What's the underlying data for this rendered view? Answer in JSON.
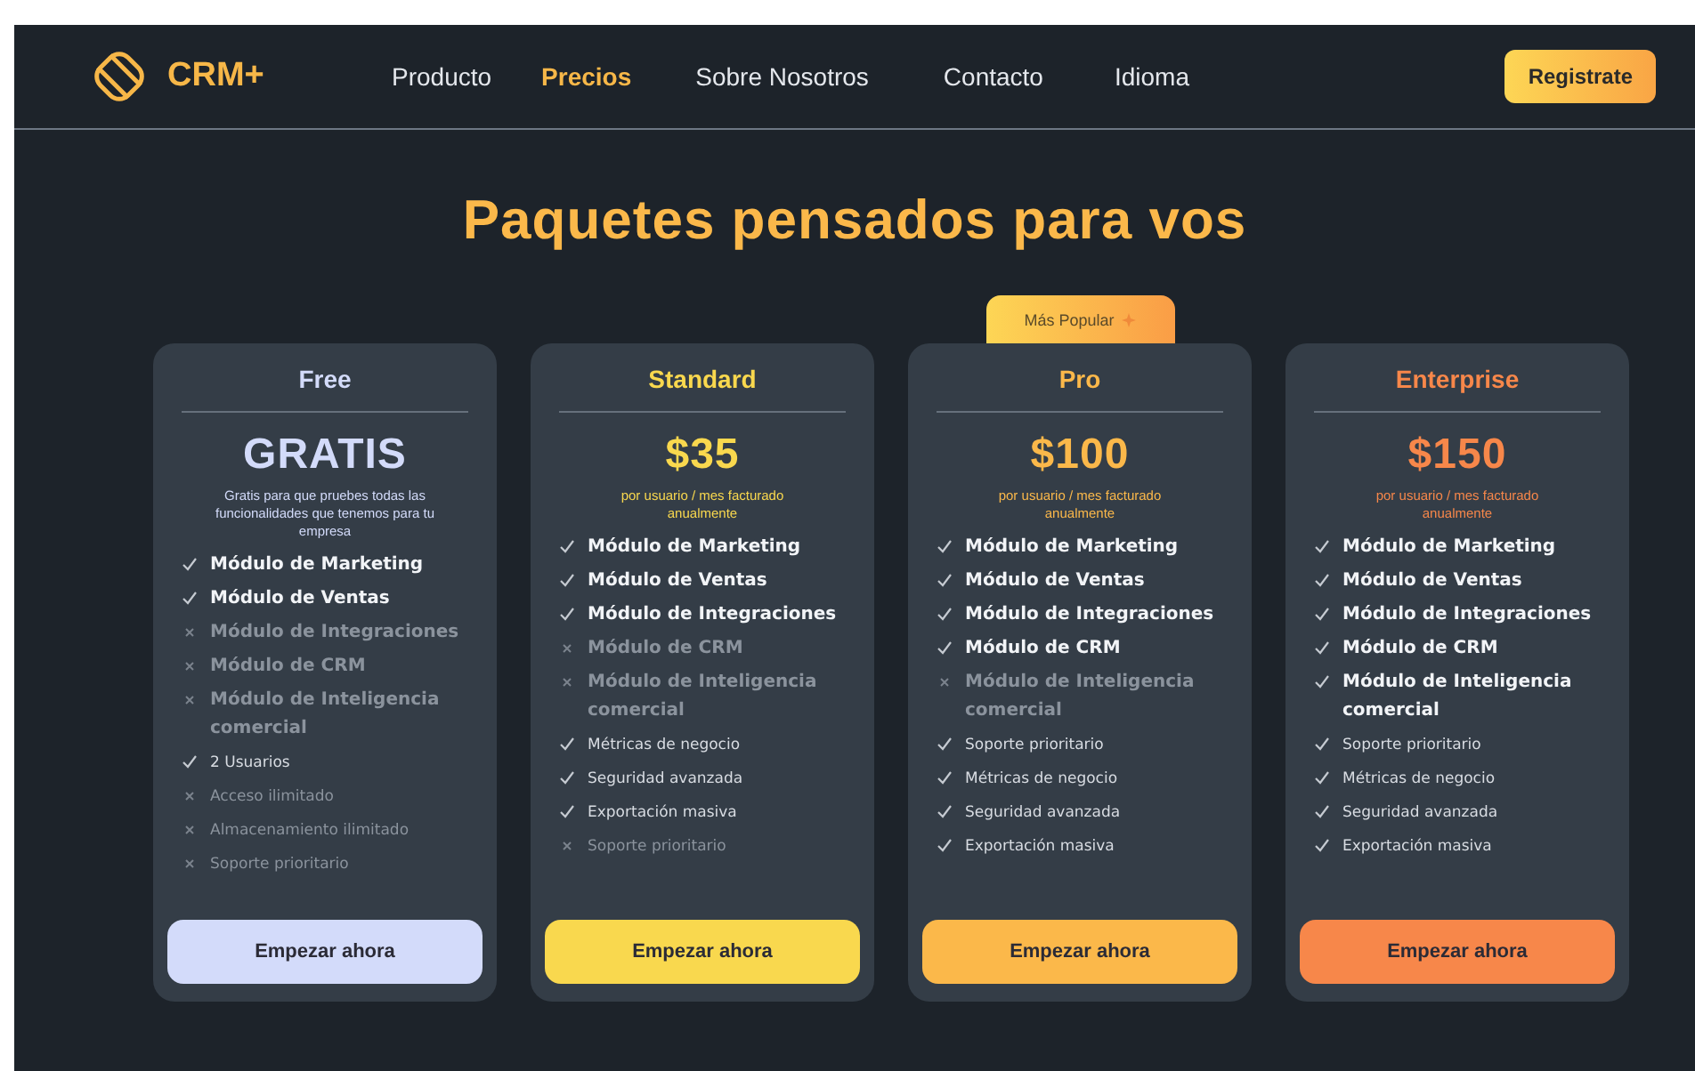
{
  "brand": {
    "name": "CRM+"
  },
  "nav": [
    {
      "label": "Producto",
      "selected": false
    },
    {
      "label": "Precios",
      "selected": true
    },
    {
      "label": "Sobre Nosotros",
      "selected": false
    },
    {
      "label": "Contacto",
      "selected": false
    },
    {
      "label": "Idioma",
      "selected": false
    }
  ],
  "register_button": "Registrate",
  "heading": "Paquetes pensados para vos",
  "plans": [
    {
      "name": "Free",
      "color": "#d3dbfa",
      "price": "GRATIS",
      "note": "Gratis para que pruebes todas las funcionalidades que tenemos para tu empresa",
      "features": [
        {
          "label": "Módulo de Marketing",
          "kind": "module",
          "included": true
        },
        {
          "label": "Módulo de Ventas",
          "kind": "module",
          "included": true
        },
        {
          "label": "Módulo de Integraciones",
          "kind": "module",
          "included": false
        },
        {
          "label": "Módulo de CRM",
          "kind": "module",
          "included": false
        },
        {
          "label": "Módulo de Inteligencia comercial",
          "kind": "module",
          "included": false
        },
        {
          "label": "2 Usuarios",
          "kind": "extra",
          "included": true
        },
        {
          "label": "Acceso ilimitado",
          "kind": "extra",
          "included": false
        },
        {
          "label": "Almacenamiento ilimitado",
          "kind": "extra",
          "included": false
        },
        {
          "label": "Soporte prioritario",
          "kind": "extra",
          "included": false
        }
      ],
      "button": "Empezar ahora"
    },
    {
      "name": "Standard",
      "color": "#f9d84e",
      "price": "$35",
      "note": "por usuario / mes facturado anualmente",
      "features": [
        {
          "label": "Módulo de Marketing",
          "kind": "module",
          "included": true
        },
        {
          "label": "Módulo de Ventas",
          "kind": "module",
          "included": true
        },
        {
          "label": "Módulo de Integraciones",
          "kind": "module",
          "included": true
        },
        {
          "label": "Módulo de CRM",
          "kind": "module",
          "included": false
        },
        {
          "label": "Módulo de Inteligencia comercial",
          "kind": "module",
          "included": false
        },
        {
          "label": "Métricas de negocio",
          "kind": "extra",
          "included": true
        },
        {
          "label": "Seguridad avanzada",
          "kind": "extra",
          "included": true
        },
        {
          "label": "Exportación masiva",
          "kind": "extra",
          "included": true
        },
        {
          "label": "Soporte prioritario",
          "kind": "extra",
          "included": false
        }
      ],
      "button": "Empezar ahora"
    },
    {
      "name": "Pro",
      "color": "#fbb84a",
      "badge": "Más Popular",
      "price": "$100",
      "note": "por usuario / mes facturado anualmente",
      "features": [
        {
          "label": "Módulo de Marketing",
          "kind": "module",
          "included": true
        },
        {
          "label": "Módulo de Ventas",
          "kind": "module",
          "included": true
        },
        {
          "label": "Módulo de Integraciones",
          "kind": "module",
          "included": true
        },
        {
          "label": "Módulo de CRM",
          "kind": "module",
          "included": true
        },
        {
          "label": "Módulo de Inteligencia comercial",
          "kind": "module",
          "included": false
        },
        {
          "label": "Soporte prioritario",
          "kind": "extra",
          "included": true
        },
        {
          "label": "Métricas de negocio",
          "kind": "extra",
          "included": true
        },
        {
          "label": "Seguridad avanzada",
          "kind": "extra",
          "included": true
        },
        {
          "label": "Exportación masiva",
          "kind": "extra",
          "included": true
        }
      ],
      "button": "Empezar ahora"
    },
    {
      "name": "Enterprise",
      "color": "#f7874a",
      "price": "$150",
      "note": "por usuario / mes facturado anualmente",
      "features": [
        {
          "label": "Módulo de Marketing",
          "kind": "module",
          "included": true
        },
        {
          "label": "Módulo de Ventas",
          "kind": "module",
          "included": true
        },
        {
          "label": "Módulo de Integraciones",
          "kind": "module",
          "included": true
        },
        {
          "label": "Módulo de CRM",
          "kind": "module",
          "included": true
        },
        {
          "label": "Módulo de Inteligencia comercial",
          "kind": "module",
          "included": true
        },
        {
          "label": "Soporte prioritario",
          "kind": "extra",
          "included": true
        },
        {
          "label": "Métricas de negocio",
          "kind": "extra",
          "included": true
        },
        {
          "label": "Seguridad avanzada",
          "kind": "extra",
          "included": true
        },
        {
          "label": "Exportación masiva",
          "kind": "extra",
          "included": true
        }
      ],
      "button": "Empezar ahora"
    }
  ]
}
